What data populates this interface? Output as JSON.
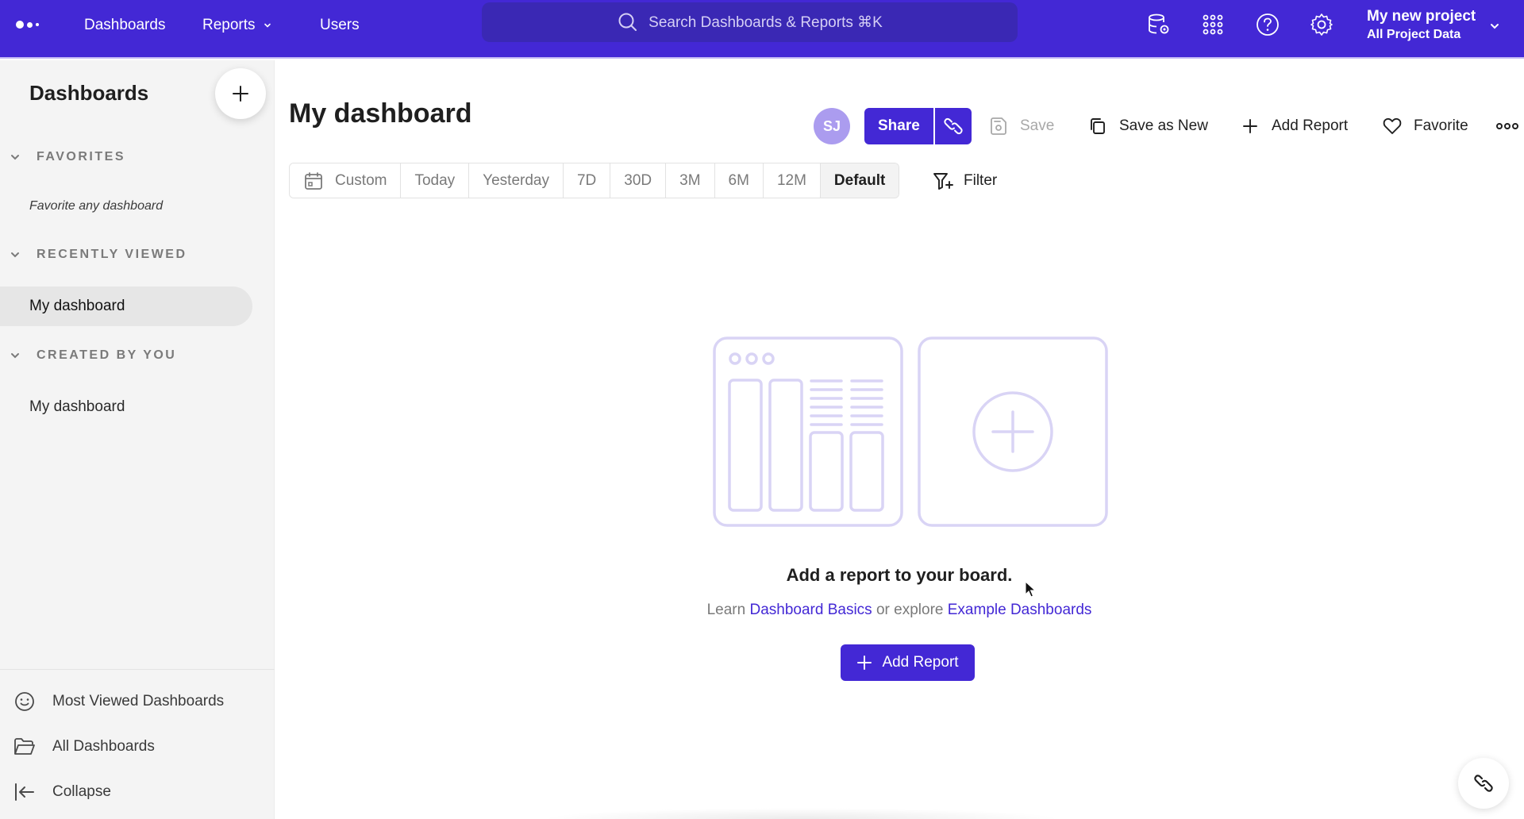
{
  "colors": {
    "brand": "#4328d5",
    "nav_bg": "#4328d5",
    "search_bg": "#3a28b4",
    "sidebar_bg": "#f4f4f4",
    "avatar_bg": "#ab9cef",
    "illustration": "#d9d4f5"
  },
  "topnav": {
    "logo_icon": "mixpanel-dots-logo",
    "links": [
      {
        "label": "Dashboards"
      },
      {
        "label": "Reports",
        "has_dropdown": true
      },
      {
        "label": "Users"
      }
    ],
    "search_placeholder": "Search Dashboards & Reports ⌘K",
    "icons": [
      "data-management-icon",
      "apps-grid-icon",
      "help-icon",
      "settings-icon"
    ],
    "project": {
      "name": "My new project",
      "scope": "All Project Data"
    }
  },
  "sidebar": {
    "title": "Dashboards",
    "add_button_icon": "plus-icon",
    "sections": [
      {
        "label": "FAVORITES",
        "empty_text": "Favorite any dashboard",
        "items": []
      },
      {
        "label": "RECENTLY VIEWED",
        "items": [
          {
            "label": "My dashboard",
            "active": true
          }
        ]
      },
      {
        "label": "CREATED BY YOU",
        "items": [
          {
            "label": "My dashboard",
            "active": false
          }
        ]
      }
    ],
    "bottom_links": [
      {
        "label": "Most Viewed Dashboards",
        "icon": "smiley-icon"
      },
      {
        "label": "All Dashboards",
        "icon": "folder-icon"
      },
      {
        "label": "Collapse",
        "icon": "collapse-left-icon"
      }
    ]
  },
  "main": {
    "title": "My dashboard",
    "avatar_initials": "SJ",
    "actions": {
      "share": "Share",
      "save": "Save",
      "save_as_new": "Save as New",
      "add_report": "Add Report",
      "favorite": "Favorite"
    },
    "date_ranges": [
      {
        "label": "Custom",
        "icon": "calendar-icon",
        "active": false
      },
      {
        "label": "Today",
        "active": false
      },
      {
        "label": "Yesterday",
        "active": false
      },
      {
        "label": "7D",
        "active": false
      },
      {
        "label": "30D",
        "active": false
      },
      {
        "label": "3M",
        "active": false
      },
      {
        "label": "6M",
        "active": false
      },
      {
        "label": "12M",
        "active": false
      },
      {
        "label": "Default",
        "active": true
      }
    ],
    "filter_label": "Filter",
    "empty_state": {
      "title": "Add a report to your board.",
      "learn_prefix": "Learn",
      "link1": "Dashboard Basics",
      "middle": "or explore",
      "link2": "Example Dashboards",
      "button": "Add Report"
    }
  }
}
